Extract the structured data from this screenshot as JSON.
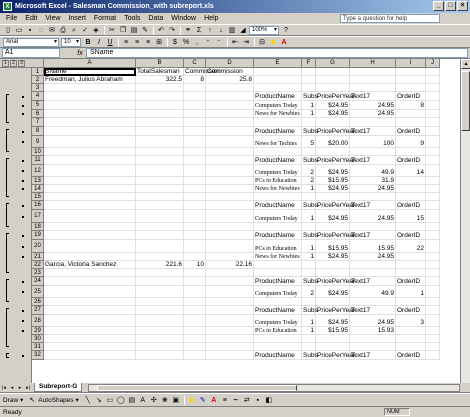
{
  "window": {
    "title": "Microsoft Excel - Salesman Commission_with subreport.xls",
    "icon": "excel-icon"
  },
  "menus": [
    "File",
    "Edit",
    "View",
    "Insert",
    "Format",
    "Tools",
    "Data",
    "Window",
    "Help"
  ],
  "help_placeholder": "Type a question for help",
  "toolbar": {
    "zoom": "100%",
    "font_name": "Arial",
    "font_size": "10",
    "bold_label": "B",
    "italic_label": "I",
    "underline_label": "U"
  },
  "formula_bar": {
    "name_box": "A1",
    "fx": "fx",
    "value": "SName"
  },
  "outline_levels": [
    "1",
    "2",
    "3"
  ],
  "columns": [
    {
      "letter": "A",
      "w": 92
    },
    {
      "letter": "B",
      "w": 48
    },
    {
      "letter": "C",
      "w": 22
    },
    {
      "letter": "D",
      "w": 48
    },
    {
      "letter": "E",
      "w": 48
    },
    {
      "letter": "F",
      "w": 14
    },
    {
      "letter": "G",
      "w": 34
    },
    {
      "letter": "H",
      "w": 46
    },
    {
      "letter": "I",
      "w": 30
    },
    {
      "letter": "J",
      "w": 14
    }
  ],
  "rows": [
    {
      "n": "1",
      "h": 8,
      "cells": {
        "A": "SName",
        "B": "TotalSalesman",
        "C": "Commission",
        "D": "Commission"
      }
    },
    {
      "n": "2",
      "h": 8,
      "cells": {
        "A": "Freedman, Julius Abraham",
        "B": "322.5",
        "C": "8",
        "D": "25.8"
      },
      "right": [
        "B",
        "C",
        "D"
      ]
    },
    {
      "n": "3",
      "h": 8,
      "cells": {}
    },
    {
      "n": "4",
      "h": 9,
      "cells": {
        "E": "ProductName",
        "F": "Subs",
        "G": "PricePerYear",
        "H": "Text17",
        "I": "OrderID"
      }
    },
    {
      "n": "5",
      "h": 9,
      "cells": {
        "E": "Computers Today",
        "F": "1",
        "G": "$24.95",
        "H": "24.95",
        "I": "8"
      },
      "right": [
        "F",
        "G",
        "H",
        "I"
      ],
      "serif": [
        "E"
      ]
    },
    {
      "n": "6",
      "h": 8,
      "cells": {
        "E": "News for Newbies",
        "F": "1",
        "G": "$24.95",
        "H": "24.95"
      },
      "right": [
        "F",
        "G",
        "H"
      ],
      "serif": [
        "E"
      ]
    },
    {
      "n": "7",
      "h": 9,
      "cells": {}
    },
    {
      "n": "8",
      "h": 9,
      "cells": {
        "E": "ProductName",
        "F": "Subs",
        "G": "PricePerYear",
        "H": "Text17",
        "I": "OrderID"
      }
    },
    {
      "n": "9",
      "h": 12,
      "cells": {
        "E": "News for Techies",
        "F": "5",
        "G": "$20.00",
        "H": "100",
        "I": "9"
      },
      "right": [
        "F",
        "G",
        "H",
        "I"
      ],
      "serif": [
        "E"
      ]
    },
    {
      "n": "10",
      "h": 8,
      "cells": {}
    },
    {
      "n": "11",
      "h": 9,
      "cells": {
        "E": "ProductName",
        "F": "Subs",
        "G": "PricePerYear",
        "H": "Text17",
        "I": "OrderID"
      }
    },
    {
      "n": "12",
      "h": 12,
      "cells": {
        "E": "Computers Today",
        "F": "2",
        "G": "$24.95",
        "H": "49.9",
        "I": "14"
      },
      "right": [
        "F",
        "G",
        "H",
        "I"
      ],
      "serif": [
        "E"
      ]
    },
    {
      "n": "13",
      "h": 8,
      "cells": {
        "E": "PCs in Education",
        "F": "2",
        "G": "$15.95",
        "H": "31.9"
      },
      "right": [
        "F",
        "G",
        "H"
      ],
      "serif": [
        "E"
      ]
    },
    {
      "n": "14",
      "h": 8,
      "cells": {
        "E": "News for Newbies",
        "F": "1",
        "G": "$24.95",
        "H": "24.95"
      },
      "right": [
        "F",
        "G",
        "H"
      ],
      "serif": [
        "E"
      ]
    },
    {
      "n": "15",
      "h": 8,
      "cells": {}
    },
    {
      "n": "16",
      "h": 9,
      "cells": {
        "E": "ProductName",
        "F": "Subs",
        "G": "PricePerYear",
        "H": "Text17",
        "I": "OrderID"
      }
    },
    {
      "n": "17",
      "h": 13,
      "cells": {
        "E": "Computers Today",
        "F": "1",
        "G": "$24.95",
        "H": "24.95",
        "I": "15"
      },
      "right": [
        "F",
        "G",
        "H",
        "I"
      ],
      "serif": [
        "E"
      ]
    },
    {
      "n": "18",
      "h": 8,
      "cells": {}
    },
    {
      "n": "19",
      "h": 9,
      "cells": {
        "E": "ProductName",
        "F": "Subs",
        "G": "PricePerYear",
        "H": "Text17",
        "I": "OrderID"
      }
    },
    {
      "n": "20",
      "h": 13,
      "cells": {
        "E": "PCs in Education",
        "F": "1",
        "G": "$15.95",
        "H": "15.95",
        "I": "22"
      },
      "right": [
        "F",
        "G",
        "H",
        "I"
      ],
      "serif": [
        "E"
      ]
    },
    {
      "n": "21",
      "h": 8,
      "cells": {
        "E": "News for Newbies",
        "F": "1",
        "G": "$24.95",
        "H": "24.95"
      },
      "right": [
        "F",
        "G",
        "H"
      ],
      "serif": [
        "E"
      ]
    },
    {
      "n": "22",
      "h": 8,
      "cells": {
        "A": "Garcia, Victoria Sanchez",
        "B": "221.6",
        "C": "10",
        "D": "22.16"
      },
      "right": [
        "B",
        "C",
        "D"
      ]
    },
    {
      "n": "23",
      "h": 8,
      "cells": {}
    },
    {
      "n": "24",
      "h": 9,
      "cells": {
        "E": "ProductName",
        "F": "Subs",
        "G": "PricePerYear",
        "H": "Text17",
        "I": "OrderID"
      }
    },
    {
      "n": "25",
      "h": 12,
      "cells": {
        "E": "Computers Today",
        "F": "2",
        "G": "$24.95",
        "H": "49.9",
        "I": "1"
      },
      "right": [
        "F",
        "G",
        "H",
        "I"
      ],
      "serif": [
        "E"
      ]
    },
    {
      "n": "26",
      "h": 8,
      "cells": {}
    },
    {
      "n": "27",
      "h": 9,
      "cells": {
        "E": "ProductName",
        "F": "Subs",
        "G": "PricePerYear",
        "H": "Text17",
        "I": "OrderID"
      }
    },
    {
      "n": "28",
      "h": 12,
      "cells": {
        "E": "Computers Today",
        "F": "1",
        "G": "$24.95",
        "H": "24.95",
        "I": "3"
      },
      "right": [
        "F",
        "G",
        "H",
        "I"
      ],
      "serif": [
        "E"
      ]
    },
    {
      "n": "29",
      "h": 8,
      "cells": {
        "E": "PCs in Education",
        "F": "1",
        "G": "$15.95",
        "H": "15.93"
      },
      "right": [
        "F",
        "G",
        "H"
      ],
      "serif": [
        "E"
      ]
    },
    {
      "n": "30",
      "h": 8,
      "cells": {}
    },
    {
      "n": "31",
      "h": 8,
      "cells": {}
    },
    {
      "n": "32",
      "h": 9,
      "cells": {
        "E": "ProductName",
        "F": "Subs",
        "G": "PricePerYear",
        "H": "Text17",
        "I": "OrderID"
      }
    }
  ],
  "sheet_tab": "Subreport-G",
  "drawbar": {
    "draw": "Draw ▾",
    "autoshapes": "AutoShapes ▾"
  },
  "status": {
    "left": "Ready",
    "num": "NUM"
  }
}
